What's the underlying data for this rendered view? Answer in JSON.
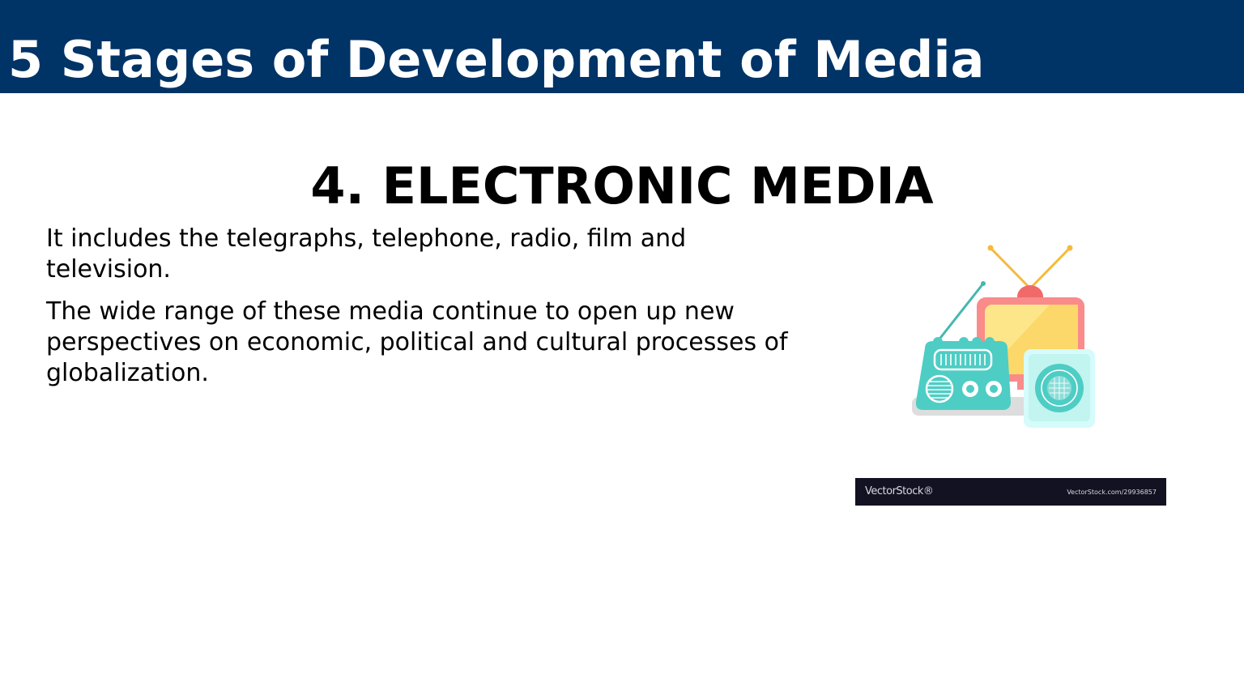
{
  "header": {
    "title": "5 Stages of Development of Media",
    "background_color": "#003366"
  },
  "section": {
    "heading": "4. ELECTRONIC MEDIA"
  },
  "body": {
    "paragraphs": [
      "It includes the telegraphs, telephone, radio, film and television.",
      "The wide range of these media continue to open up new perspectives on economic, political and cultural processes of globalization."
    ]
  },
  "illustration": {
    "icon": "radio-tv-illustration",
    "colors": {
      "tv_frame": "#f98b8b",
      "tv_screen": "#fde68a",
      "radio": "#4ecdc4",
      "antenna": "#f6b93b"
    }
  },
  "watermark": {
    "logo": "VectorStock®",
    "url": "VectorStock.com/29936857"
  }
}
